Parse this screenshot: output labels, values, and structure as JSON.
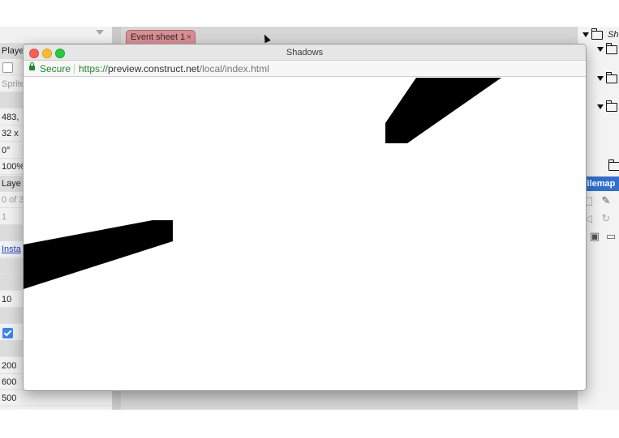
{
  "ide": {
    "event_tab_label": "Event sheet 1",
    "left_properties": [
      {
        "text": "Playe",
        "style": "shade"
      },
      {
        "text": "",
        "style": "checkbox"
      },
      {
        "text": "Sprite",
        "style": "muted"
      },
      {
        "text": "",
        "style": "shade"
      },
      {
        "text": "483, ",
        "style": ""
      },
      {
        "text": "32 x ",
        "style": ""
      },
      {
        "text": "0°",
        "style": ""
      },
      {
        "text": "100%",
        "style": ""
      },
      {
        "text": "Laye",
        "style": "shade"
      },
      {
        "text": "0 of 3",
        "style": "muted"
      },
      {
        "text": "1",
        "style": "muted"
      },
      {
        "text": "",
        "style": "shade"
      },
      {
        "text": "Insta",
        "style": "link"
      },
      {
        "text": "",
        "style": "shade"
      },
      {
        "text": "",
        "style": "shade"
      },
      {
        "text": "10",
        "style": ""
      },
      {
        "text": "",
        "style": "shade"
      },
      {
        "text": "",
        "style": "checked"
      },
      {
        "text": "",
        "style": "shade"
      },
      {
        "text": "200",
        "style": ""
      },
      {
        "text": "600",
        "style": ""
      },
      {
        "text": "500",
        "style": ""
      }
    ],
    "tree_top_label": "Sh",
    "tilemap_label": "Tilemap"
  },
  "window": {
    "title": "Shadows",
    "secure_label": "Secure",
    "url_scheme": "https://",
    "url_host": "preview.construct.net",
    "url_path": "/local/index.html"
  },
  "colors": {
    "shape_fill": "#000000",
    "tab_bg": "#d98e94",
    "tilemap_bar": "#2f6fd0",
    "secure_green": "#1e8a2e"
  }
}
